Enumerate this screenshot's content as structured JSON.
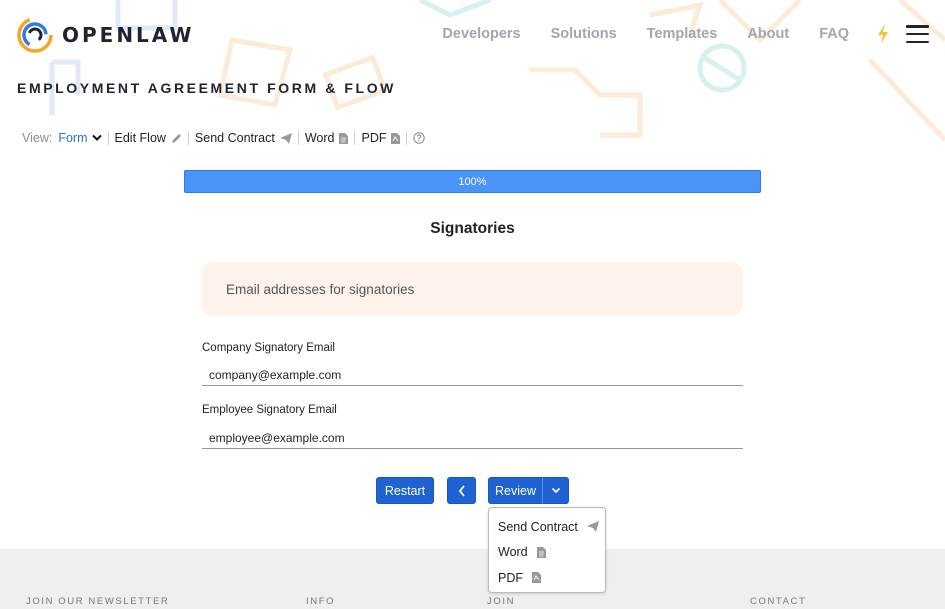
{
  "header": {
    "brand": "OPENLAW",
    "nav": [
      "Developers",
      "Solutions",
      "Templates",
      "About",
      "FAQ"
    ],
    "icons": [
      "lightning-icon",
      "hamburger-menu-icon"
    ]
  },
  "page_title": "EMPLOYMENT AGREEMENT FORM & FLOW",
  "toolbar": {
    "view_label": "View:",
    "view_value": "Form",
    "edit_flow": "Edit Flow",
    "send_contract": "Send Contract",
    "word": "Word",
    "pdf": "PDF"
  },
  "progress": {
    "label": "100%",
    "value": 100,
    "color": "#4a94f7"
  },
  "section_title": "Signatories",
  "note": "Email addresses for signatories",
  "fields": {
    "company": {
      "label": "Company Signatory Email",
      "value": "company@example.com"
    },
    "employee": {
      "label": "Employee Signatory Email",
      "value": "employee@example.com"
    }
  },
  "buttons": {
    "restart": "Restart",
    "review": "Review"
  },
  "dropdown": {
    "items": [
      "Send Contract",
      "Word",
      "PDF"
    ]
  },
  "footer": {
    "columns": [
      "JOIN OUR NEWSLETTER",
      "INFO",
      "JOIN",
      "CONTACT"
    ]
  },
  "colors": {
    "accent": "#1f63d3",
    "link": "#2f6fd1",
    "note_bg": "#fdf3ea"
  }
}
